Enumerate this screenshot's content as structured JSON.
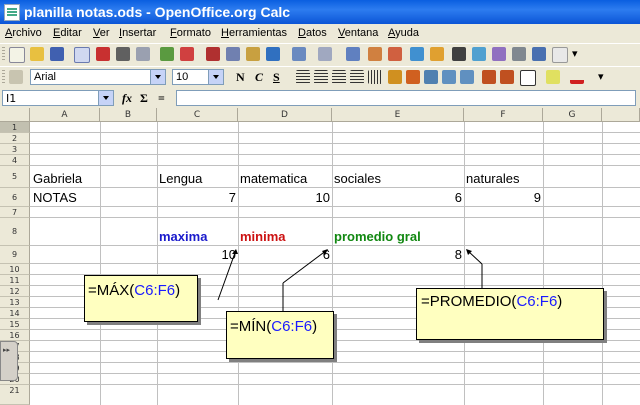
{
  "window": {
    "title": "planilla notas.ods - OpenOffice.org Calc"
  },
  "menu": [
    "Archivo",
    "Editar",
    "Ver",
    "Insertar",
    "Formato",
    "Herramientas",
    "Datos",
    "Ventana",
    "Ayuda"
  ],
  "format_bar": {
    "font_name": "Arial",
    "font_size": "10",
    "bold": "N",
    "italic": "C",
    "underline": "S"
  },
  "formula_bar": {
    "name_box": "I1",
    "fx": "fx",
    "sum": "Σ",
    "equals": "=",
    "content": ""
  },
  "columns": [
    "A",
    "B",
    "C",
    "D",
    "E",
    "F",
    "G"
  ],
  "rows": [
    "1",
    "2",
    "3",
    "4",
    "5",
    "6",
    "7",
    "8",
    "9",
    "10",
    "11",
    "12",
    "13",
    "14",
    "15",
    "16",
    "17",
    "18",
    "19",
    "20",
    "21"
  ],
  "cells": {
    "A5": "Gabriela",
    "C5": "Lengua",
    "D5": "matematica",
    "E5": "sociales",
    "F5": "naturales",
    "A6": "NOTAS",
    "C6": "7",
    "D6": "10",
    "E6": "6",
    "F6": "9",
    "C8": "maxima",
    "D8": "minima",
    "E8": "promedio gral",
    "C9": "10",
    "D9": "6",
    "E9": "8"
  },
  "callouts": [
    {
      "func": "=MÁX(",
      "range": "C6:F6",
      "close": ")"
    },
    {
      "func": "=MÍN(",
      "range": "C6:F6",
      "close": ")"
    },
    {
      "func": "=PROMEDIO(",
      "range": "C6:F6",
      "close": ")"
    }
  ],
  "colors": {
    "maxima": "#1a1acc",
    "minima": "#cc1111",
    "promedio": "#118811",
    "titlebar": "#0a5fe0"
  }
}
